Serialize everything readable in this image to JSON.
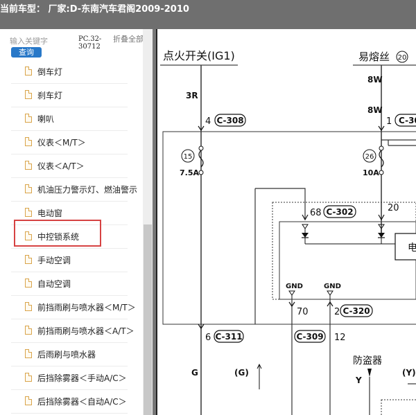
{
  "header": {
    "title": "当前车型：  厂家:D-东南汽车君阁2009-2010"
  },
  "sidebar": {
    "search_placeholder": "输入关键字",
    "search_button": "查询",
    "pc_code": "PC.32-30712",
    "collapse_all": "折叠全部",
    "items": [
      {
        "label": "倒车灯"
      },
      {
        "label": "刹车灯"
      },
      {
        "label": "喇叭"
      },
      {
        "label": "仪表＜M/T＞"
      },
      {
        "label": "仪表＜A/T＞"
      },
      {
        "label": "机油压力警示灯、燃油警示"
      },
      {
        "label": "电动窗"
      },
      {
        "label": "中控锁系统"
      },
      {
        "label": "手动空调"
      },
      {
        "label": "自动空调"
      },
      {
        "label": "前挡雨刷与喷水器＜M/T＞"
      },
      {
        "label": "前挡雨刷与喷水器＜A/T＞"
      },
      {
        "label": "后雨刷与喷水器"
      },
      {
        "label": "后挡除雾器＜手动A/C＞"
      },
      {
        "label": "后挡除雾器＜自动A/C＞"
      }
    ],
    "selected_index": 7
  },
  "diagram": {
    "ignition_label": "点火开关(IG1)",
    "fuse_label": "易熔丝",
    "fuse_num": "20",
    "wire_3r": "3R",
    "wire_8w_a": "8W",
    "wire_8w_b": "8W",
    "pin_4": "4",
    "conn_c308": "C-308",
    "pin_1": "1",
    "conn_c30x": "C-30",
    "fuse15": "15",
    "fuse15_amp": "7.5A",
    "fuse26": "26",
    "fuse26_amp": "10A",
    "pin_68": "68",
    "conn_c302": "C-302",
    "pin_20": "20",
    "gnd1": "GND",
    "gnd2": "GND",
    "pin_70": "70",
    "pin_2": "2",
    "conn_c320": "C-320",
    "pin_6": "6",
    "conn_c311": "C-311",
    "conn_c309": "C-309",
    "pin_12": "12",
    "wire_g": "G",
    "wire_g_paren": "(G)",
    "anti_theft": "防盗器",
    "wire_y": "Y",
    "wire_y_paren": "(Y)",
    "module_partial": "电"
  }
}
